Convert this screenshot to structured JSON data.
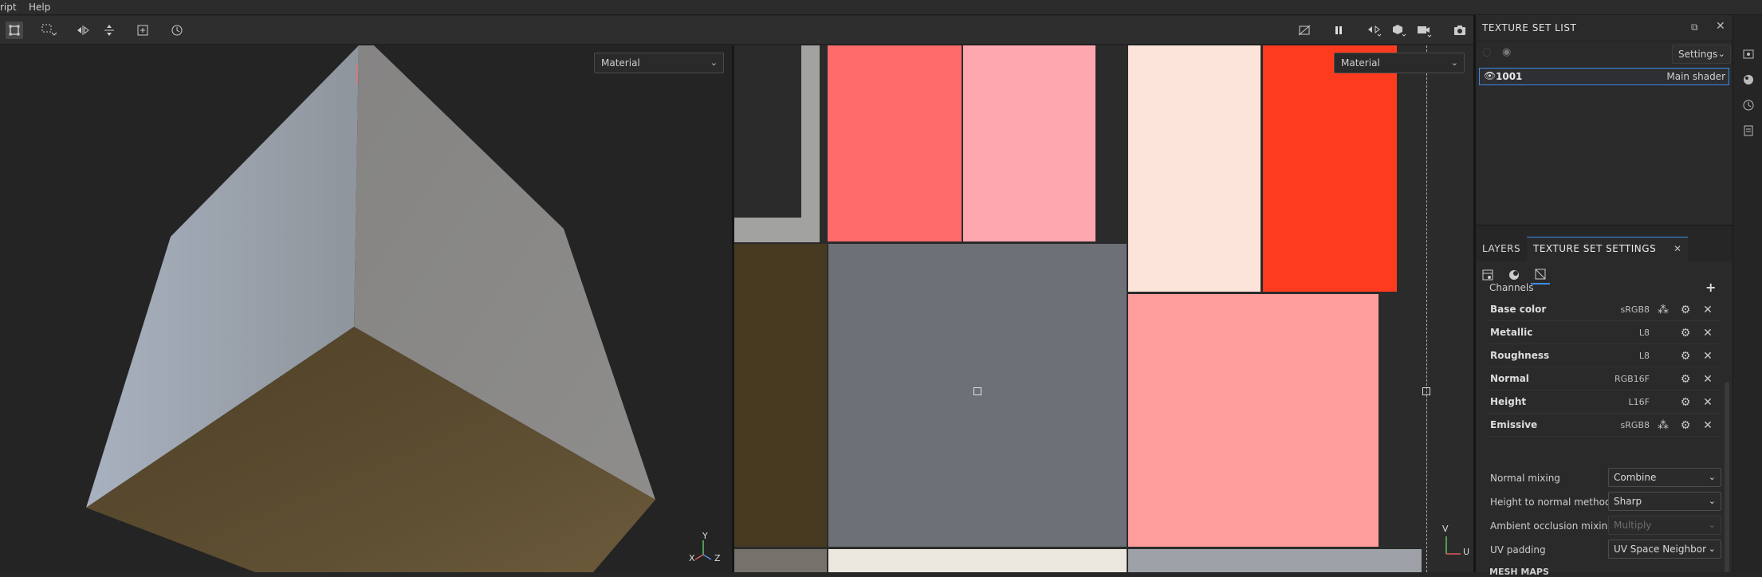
{
  "menu": {
    "items": [
      "ript",
      "Help"
    ]
  },
  "toolbar": {
    "left_icons": [
      "polygon-select-icon",
      "marquee-select-icon",
      "mirror-icon",
      "align-icon",
      "add-icon",
      "history-icon"
    ],
    "right_icons": [
      "hide-icon",
      "pause-icon",
      "symmetry-icon",
      "cube-view-icon",
      "camera-icon",
      "screenshot-icon"
    ]
  },
  "viewport3d": {
    "material_select": "Material",
    "axis_labels": {
      "y": "Y",
      "x": "X",
      "z": "Z"
    }
  },
  "viewport2d": {
    "material_select": "Material",
    "axis_labels": {
      "v": "V",
      "u": "U"
    }
  },
  "texture_set_list": {
    "title": "TEXTURE SET LIST",
    "settings_label": "Settings",
    "items": [
      {
        "id": "1001",
        "shader": "Main shader"
      }
    ]
  },
  "tabs": {
    "layers": "LAYERS",
    "texture_set_settings": "TEXTURE SET SETTINGS"
  },
  "channels": {
    "title": "Channels",
    "items": [
      {
        "name": "Base color",
        "format": "sRGB8"
      },
      {
        "name": "Metallic",
        "format": "L8"
      },
      {
        "name": "Roughness",
        "format": "L8"
      },
      {
        "name": "Normal",
        "format": "RGB16F"
      },
      {
        "name": "Height",
        "format": "L16F"
      },
      {
        "name": "Emissive",
        "format": "sRGB8"
      }
    ]
  },
  "properties": [
    {
      "label": "Normal mixing",
      "value": "Combine",
      "enabled": true
    },
    {
      "label": "Height to normal method",
      "value": "Sharp",
      "enabled": true
    },
    {
      "label": "Ambient occlusion mixing",
      "value": "Multiply",
      "enabled": false
    },
    {
      "label": "UV padding",
      "value": "UV Space Neighbor",
      "enabled": true
    }
  ],
  "mesh_maps_partial": "MESH MAPS",
  "colors": {
    "accent": "#3c8ce7",
    "uv_red": "#ff6b6b",
    "uv_pink": "#ffa7ae",
    "uv_cream": "#fde4da",
    "uv_orange_red": "#ff3b1f",
    "uv_salmon": "#ff9d9d",
    "uv_gray": "#6d7076",
    "uv_brown": "#473a21",
    "cube_bottom": "#5f4f33",
    "cube_side": "#8d8f93"
  }
}
